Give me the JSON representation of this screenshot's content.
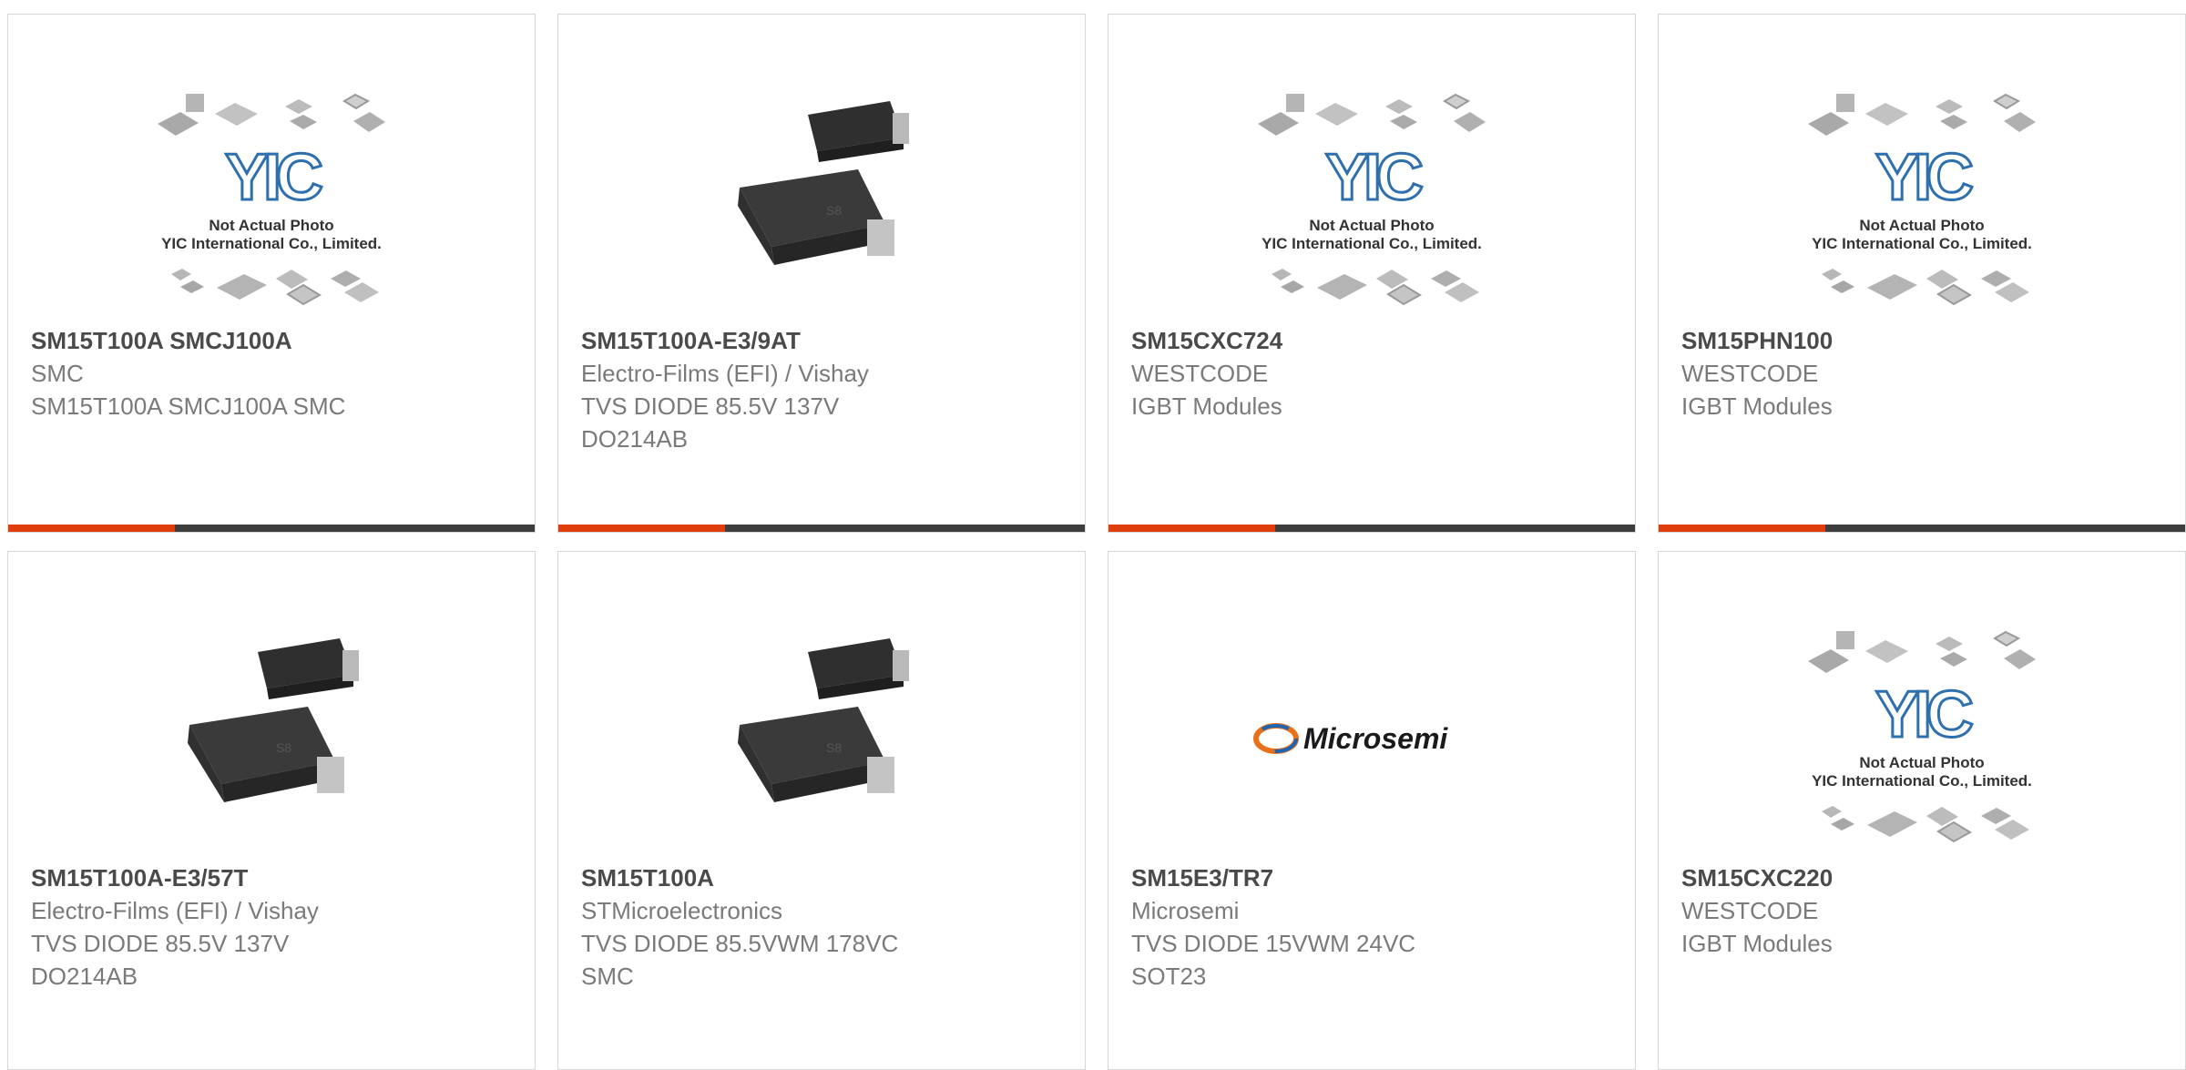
{
  "colors": {
    "accent": "#e03d0d",
    "bar": "#3d3d3d",
    "title": "#4a4a4a",
    "text": "#7a7a7a"
  },
  "placeholder": {
    "logo": "YIC",
    "caption1": "Not Actual Photo",
    "caption2": "YIC International Co., Limited."
  },
  "microsemi_logo_text": "Microsemi",
  "products": [
    {
      "part": "SM15T100A SMCJ100A",
      "manufacturer": "SMC",
      "desc1": "SM15T100A SMCJ100A SMC",
      "desc2": "",
      "image": "yic-placeholder"
    },
    {
      "part": "SM15T100A-E3/9AT",
      "manufacturer": "Electro-Films (EFI) / Vishay",
      "desc1": "TVS DIODE 85.5V 137V",
      "desc2": "DO214AB",
      "image": "smc-diode"
    },
    {
      "part": "SM15CXC724",
      "manufacturer": "WESTCODE",
      "desc1": "IGBT Modules",
      "desc2": "",
      "image": "yic-placeholder"
    },
    {
      "part": "SM15PHN100",
      "manufacturer": "WESTCODE",
      "desc1": "IGBT Modules",
      "desc2": "",
      "image": "yic-placeholder"
    },
    {
      "part": "SM15T100A-E3/57T",
      "manufacturer": "Electro-Films (EFI) / Vishay",
      "desc1": "TVS DIODE 85.5V 137V",
      "desc2": "DO214AB",
      "image": "smc-diode"
    },
    {
      "part": "SM15T100A",
      "manufacturer": "STMicroelectronics",
      "desc1": "TVS DIODE 85.5VWM 178VC",
      "desc2": "SMC",
      "image": "smc-diode"
    },
    {
      "part": "SM15E3/TR7",
      "manufacturer": "Microsemi",
      "desc1": "TVS DIODE 15VWM 24VC",
      "desc2": "SOT23",
      "image": "microsemi-logo"
    },
    {
      "part": "SM15CXC220",
      "manufacturer": "WESTCODE",
      "desc1": "IGBT Modules",
      "desc2": "",
      "image": "yic-placeholder"
    }
  ]
}
